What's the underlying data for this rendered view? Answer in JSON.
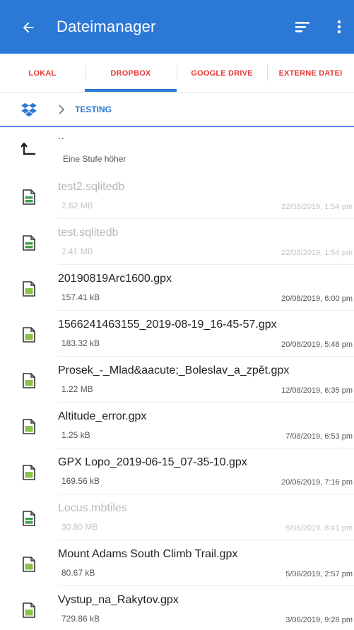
{
  "appbar": {
    "title": "Dateimanager",
    "back_icon": "arrow-left-icon",
    "sort_icon": "sort-icon",
    "more_icon": "more-vert-icon"
  },
  "tabs": [
    {
      "label": "LOKAL",
      "active": false
    },
    {
      "label": "DROPBOX",
      "active": true
    },
    {
      "label": "GOOGLE DRIVE",
      "active": false
    },
    {
      "label": "EXTERNE DATEI",
      "active": false
    }
  ],
  "breadcrumb": {
    "root_icon": "dropbox-icon",
    "separator_icon": "chevron-right-icon",
    "folder": "TESTING"
  },
  "up_row": {
    "icon": "level-up-icon",
    "name": "..",
    "description": "Eine Stufe höher"
  },
  "files": [
    {
      "name": "test2.sqlitedb",
      "size": "2.62 MB",
      "date": "22/08/2019, 1:54 pm",
      "type": "sqlitedb",
      "disabled": true
    },
    {
      "name": "test.sqlitedb",
      "size": "2.41 MB",
      "date": "22/08/2019, 1:54 pm",
      "type": "sqlitedb",
      "disabled": true
    },
    {
      "name": "20190819Arc1600.gpx",
      "size": "157.41 kB",
      "date": "20/08/2019, 6:00 pm",
      "type": "gpx",
      "disabled": false
    },
    {
      "name": "1566241463155_2019-08-19_16-45-57.gpx",
      "size": "183.32 kB",
      "date": "20/08/2019, 5:48 pm",
      "type": "gpx",
      "disabled": false
    },
    {
      "name": "Prosek_-_Mlad&aacute;_Boleslav_a_zpět.gpx",
      "size": "1.22 MB",
      "date": "12/08/2019, 6:35 pm",
      "type": "gpx",
      "disabled": false
    },
    {
      "name": "Altitude_error.gpx",
      "size": "1.25 kB",
      "date": "7/08/2019, 6:53 pm",
      "type": "gpx",
      "disabled": false
    },
    {
      "name": "GPX Lopo_2019-06-15_07-35-10.gpx",
      "size": "169.56 kB",
      "date": "20/06/2019, 7:16 pm",
      "type": "gpx",
      "disabled": false
    },
    {
      "name": "Locus.mbtiles",
      "size": "30.80 MB",
      "date": "5/06/2019, 8:41 pm",
      "type": "mbtiles",
      "disabled": true
    },
    {
      "name": "Mount Adams South Climb Trail.gpx",
      "size": "80.67 kB",
      "date": "5/06/2019, 2:57 pm",
      "type": "gpx",
      "disabled": false
    },
    {
      "name": "Vystup_na_Rakytov.gpx",
      "size": "729.86 kB",
      "date": "3/06/2019, 9:28 pm",
      "type": "gpx",
      "disabled": false
    }
  ],
  "colors": {
    "primary": "#2b78d6",
    "tab_text": "#e53935",
    "gpx_green": "#8bc34a",
    "db_green": "#43a047"
  }
}
